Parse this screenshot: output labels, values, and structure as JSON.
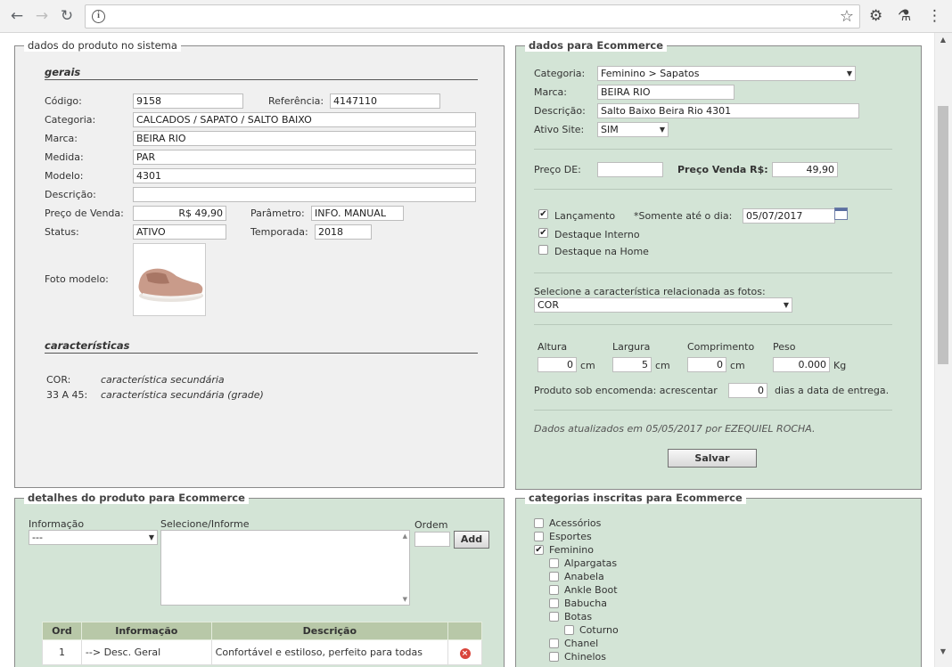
{
  "browser": {
    "back_label": "←",
    "forward_label": "→",
    "reload_label": "↻",
    "url": "",
    "info_label": "i",
    "star_label": "☆",
    "gear_label": "⚙",
    "eyedrop_label": "⚗",
    "menu_label": "⋮"
  },
  "produto": {
    "legend": "dados do produto no sistema",
    "gerais_title": "gerais",
    "codigo_label": "Código:",
    "codigo": "9158",
    "referencia_label": "Referência:",
    "referencia": "4147110",
    "categoria_label": "Categoria:",
    "categoria": "CALCADOS / SAPATO / SALTO BAIXO",
    "marca_label": "Marca:",
    "marca": "BEIRA RIO",
    "medida_label": "Medida:",
    "medida": "PAR",
    "modelo_label": "Modelo:",
    "modelo": "4301",
    "descricao_label": "Descrição:",
    "descricao": "",
    "preco_label": "Preço de Venda:",
    "preco": "R$ 49,90",
    "parametro_label": "Parâmetro:",
    "parametro": "INFO. MANUAL",
    "status_label": "Status:",
    "status": "ATIVO",
    "temporada_label": "Temporada:",
    "temporada": "2018",
    "foto_label": "Foto modelo:",
    "caracteristicas_title": "características",
    "caracteristicas": [
      {
        "key": "COR:",
        "value": "característica secundária"
      },
      {
        "key": "33 A 45:",
        "value": "característica secundária (grade)"
      }
    ]
  },
  "ecommerce": {
    "legend": "dados para Ecommerce",
    "categoria_label": "Categoria:",
    "categoria": "Feminino > Sapatos",
    "marca_label": "Marca:",
    "marca": "BEIRA RIO",
    "descricao_label": "Descrição:",
    "descricao": "Salto Baixo Beira Rio 4301",
    "ativo_label": "Ativo Site:",
    "ativo": "SIM",
    "preco_de_label": "Preço DE:",
    "preco_de": "",
    "preco_venda_label": "Preço Venda R$:",
    "preco_venda": "49,90",
    "lancamento_label": "Lançamento",
    "lancamento_checked": true,
    "somente_label": "*Somente até o dia:",
    "somente_date": "05/07/2017",
    "destaque_interno_label": "Destaque Interno",
    "destaque_interno_checked": true,
    "destaque_home_label": "Destaque na Home",
    "destaque_home_checked": false,
    "caracteristica_label": "Selecione a característica relacionada as fotos:",
    "caracteristica": "COR",
    "altura_label": "Altura",
    "altura": "0",
    "largura_label": "Largura",
    "largura": "5",
    "comprimento_label": "Comprimento",
    "comprimento": "0",
    "peso_label": "Peso",
    "peso": "0.000",
    "cm_label": "cm",
    "kg_label": "Kg",
    "encomenda_label": "Produto sob encomenda: acrescentar",
    "encomenda_dias": "0",
    "encomenda_suffix": "dias a data de entrega.",
    "atualizado": "Dados atualizados em 05/05/2017 por EZEQUIEL ROCHA.",
    "salvar_label": "Salvar"
  },
  "detalhes": {
    "legend": "detalhes do produto para Ecommerce",
    "informacao_label": "Informação",
    "informacao": "---",
    "selecione_label": "Selecione/Informe",
    "ordem_label": "Ordem",
    "ordem": "",
    "add_label": "Add",
    "table": {
      "headers": [
        "Ord",
        "Informação",
        "Descrição"
      ],
      "rows": [
        {
          "ord": "1",
          "info": "--> Desc. Geral",
          "desc": "Confortável e estiloso, perfeito para todas"
        }
      ],
      "delete_label": "×"
    }
  },
  "categorias": {
    "legend": "categorias inscritas para Ecommerce",
    "items": [
      {
        "label": "Acessórios",
        "checked": false,
        "level": 0
      },
      {
        "label": "Esportes",
        "checked": false,
        "level": 0
      },
      {
        "label": "Feminino",
        "checked": true,
        "level": 0
      },
      {
        "label": "Alpargatas",
        "checked": false,
        "level": 1
      },
      {
        "label": "Anabela",
        "checked": false,
        "level": 1
      },
      {
        "label": "Ankle Boot",
        "checked": false,
        "level": 1
      },
      {
        "label": "Babucha",
        "checked": false,
        "level": 1
      },
      {
        "label": "Botas",
        "checked": false,
        "level": 1
      },
      {
        "label": "Coturno",
        "checked": false,
        "level": 2
      },
      {
        "label": "Chanel",
        "checked": false,
        "level": 1
      },
      {
        "label": "Chinelos",
        "checked": false,
        "level": 1
      }
    ]
  }
}
